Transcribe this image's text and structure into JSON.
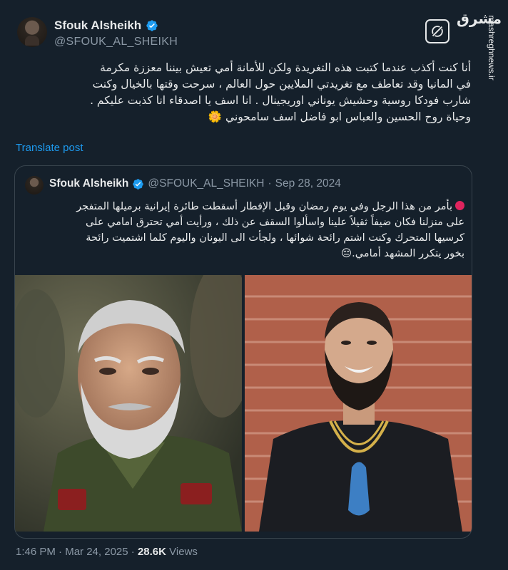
{
  "author": {
    "name": "Sfouk Alsheikh",
    "handle": "@SFOUK_AL_SHEIKH",
    "verified": true
  },
  "watermark": {
    "logo_text": "مشرق",
    "site": "mashreghnews.ir"
  },
  "tweet": {
    "lines": [
      "أنا كنت أكذب عندما كتبت هذه التغريدة ولكن للأمانة أمي تعيش بيننا معززة مكرمة",
      "في المانيا  وقد تعاطف مع تغريدتي الملايين حول العالم ، سرحت وقتها بالخيال وكنت",
      "شارب فودكا روسية وحشيش يوناني اوريجينال . انا اسف يا اصدقاء انا كذبت عليكم .",
      "وحياة روح الحسين والعباس ابو فاضل اسف سامحوني 🌼"
    ],
    "translate_label": "Translate post"
  },
  "quoted": {
    "name": "Sfouk Alsheikh",
    "handle": "@SFOUK_AL_SHEIKH",
    "separator": "·",
    "date": "Sep 28, 2024",
    "lines": [
      "بأمر من هذا الرجل وفي يوم رمضان وقبل الإفطار أسقطت طائرة إيرانية برميلها المتفجر",
      "على منزلنا فكان ضيفاً ثقيلاً علينا واسألوا السقف عن ذلك ، ورأيت أمي تحترق امامي على",
      "كرسيها المتحرك وكنت اشتم رائحة شوائها ، ولجأت الى اليونان واليوم كلما اشتميت رائحة",
      "بخور يتكرر المشهد أمامي.😔"
    ]
  },
  "meta": {
    "time": "1:46 PM",
    "separator": "·",
    "date": "Mar 24, 2025",
    "views_count": "28.6K",
    "views_label": "Views"
  },
  "colors": {
    "background": "#15202b",
    "link": "#1d9bf0",
    "verified": "#1d9bf0",
    "secondary_text": "#8b98a5"
  },
  "icons": [
    "verified-badge-icon",
    "grok-icon",
    "red-circle-icon"
  ]
}
